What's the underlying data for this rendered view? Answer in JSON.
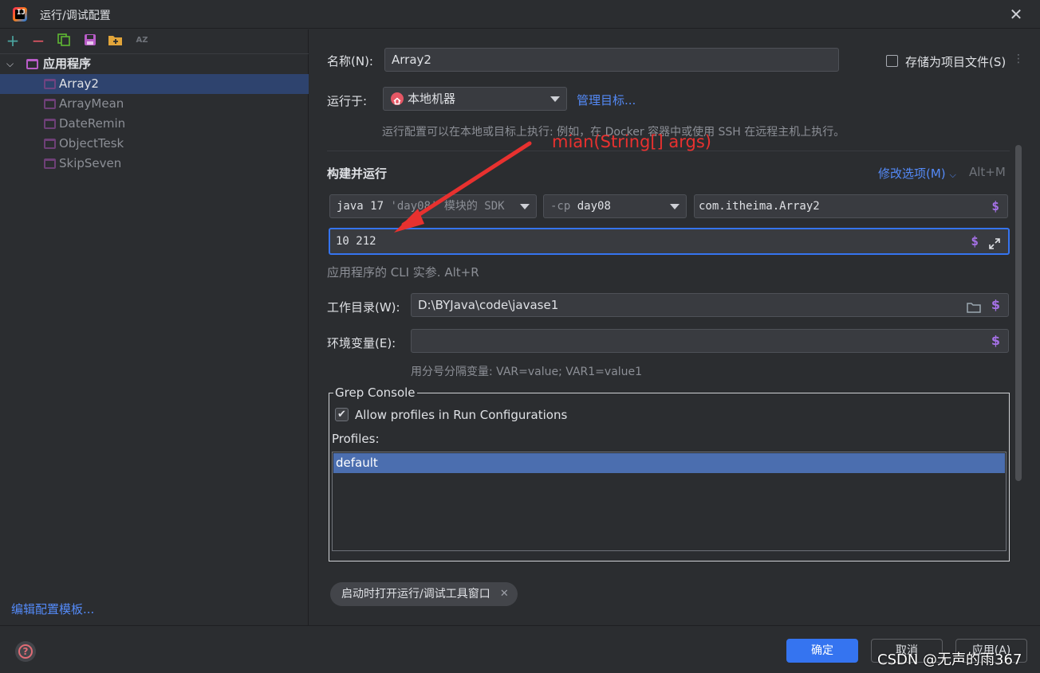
{
  "window": {
    "title": "运行/调试配置",
    "close": "✕",
    "logo": "IJ"
  },
  "toolbar": {
    "add": "+",
    "remove": "−",
    "sort": "AZ"
  },
  "tree": {
    "group": "应用程序",
    "items": [
      {
        "label": "Array2",
        "selected": true
      },
      {
        "label": "ArrayMean"
      },
      {
        "label": "DateRemin"
      },
      {
        "label": "ObjectTesk"
      },
      {
        "label": "SkipSeven"
      }
    ]
  },
  "edit_templates_link": "编辑配置模板...",
  "form": {
    "name_label": "名称(N):",
    "name_value": "Array2",
    "store_as_project_file": "存储为项目文件(S)",
    "run_on_label": "运行于:",
    "run_on_value": "本地机器",
    "manage_targets": "管理目标...",
    "run_on_hint": "运行配置可以在本地或目标上执行: 例如，在 Docker 容器中或使用 SSH 在远程主机上执行。",
    "build_run_title": "构建并运行",
    "modify_options": "修改选项(M)",
    "modify_options_shortcut": "Alt+M",
    "jdk_value_main": "java 17",
    "jdk_value_rest": " 'day08' 模块的 SDK",
    "cp_prefix": "-cp",
    "cp_value": "day08",
    "main_class": "com.itheima.Array2",
    "program_args": "10 212",
    "program_args_hint": "应用程序的 CLI 实参. Alt+R",
    "workdir_label": "工作目录(W):",
    "workdir_value": "D:\\BYJava\\code\\javase1",
    "env_label": "环境变量(E):",
    "env_value": "",
    "env_hint": "用分号分隔变量: VAR=value; VAR1=value1",
    "dollar": "$"
  },
  "grep_console": {
    "title": "Grep Console",
    "allow_profiles": "Allow profiles in Run Configurations",
    "allow_profiles_checked": true,
    "profiles_label": "Profiles:",
    "profiles": [
      "default"
    ]
  },
  "tool_window_chip": "启动时打开运行/调试工具窗口",
  "buttons": {
    "ok": "确定",
    "cancel": "取消",
    "apply": "应用(A)"
  },
  "annotation": {
    "text": "mian(String[] args)",
    "color": "#e8312f"
  },
  "watermark": "CSDN @无声的雨367",
  "colors": {
    "accent": "#3574f0",
    "link": "#548af7",
    "selection": "#2e436e",
    "profile_selection": "#4b6eaf",
    "dollar": "#a571e6"
  }
}
